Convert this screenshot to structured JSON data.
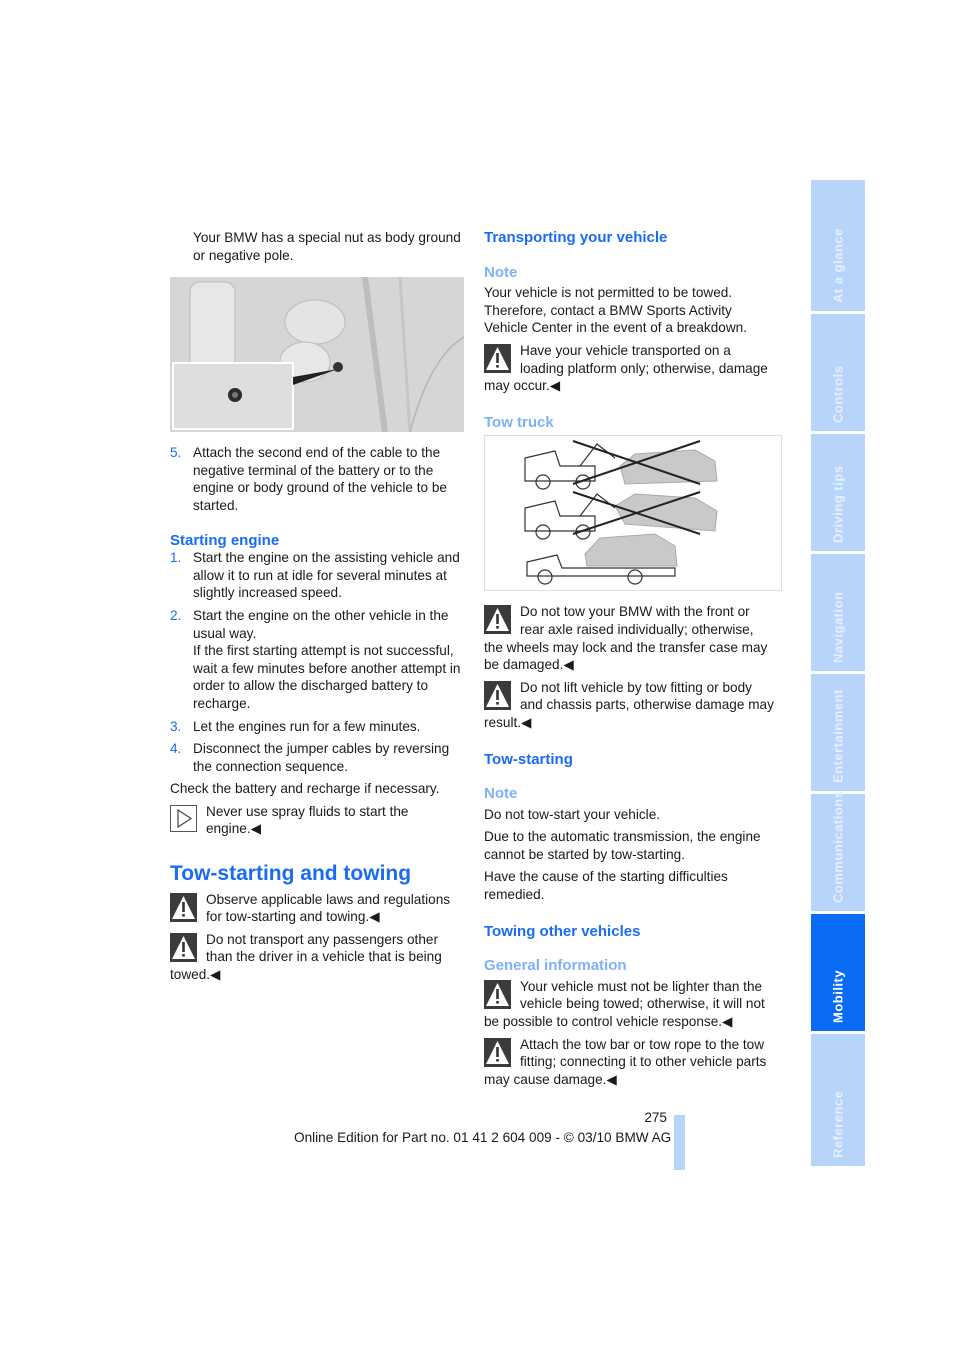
{
  "left_column": {
    "intro_text": "Your BMW has a special nut as body ground or negative pole.",
    "figure1_alt": "engine-compartment-ground-nut-illustration",
    "step5": {
      "num": "5.",
      "text": "Attach the second end of the cable to the negative terminal of the battery or to the engine or body ground of the vehicle to be started."
    },
    "starting_engine": {
      "heading": "Starting engine",
      "steps": [
        {
          "num": "1.",
          "text": "Start the engine on the assisting vehicle and allow it to run at idle for several minutes at slightly increased speed."
        },
        {
          "num": "2.",
          "text": "Start the engine on the other vehicle in the usual way.",
          "extra": "If the first starting attempt is not successful, wait a few minutes before another attempt in order to allow the discharged battery to recharge."
        },
        {
          "num": "3.",
          "text": "Let the engines run for a few minutes."
        },
        {
          "num": "4.",
          "text": "Disconnect the jumper cables by reversing the connection sequence."
        }
      ],
      "check_text": "Check the battery and recharge if necessary.",
      "note": "Never use spray fluids to start the engine.◀"
    },
    "tow_section": {
      "heading": "Tow-starting and towing",
      "warnings": [
        "Observe applicable laws and regulations for tow-starting and towing.◀",
        "Do not transport any passengers other than the driver in a vehicle that is being towed.◀"
      ]
    }
  },
  "right_column": {
    "transporting": {
      "heading": "Transporting your vehicle",
      "note_heading": "Note",
      "note_text": "Your vehicle is not permitted to be towed. Therefore, contact a BMW Sports Activity Vehicle Center in the event of a breakdown.",
      "warning": "Have your vehicle transported on a loading platform only; otherwise, damage may occur.◀"
    },
    "tow_truck": {
      "heading": "Tow truck",
      "figure_alt": "tow-truck-methods-illustration",
      "warnings": [
        "Do not tow your BMW with the front or rear axle raised individually; otherwise, the wheels may lock and the transfer case may be damaged.◀",
        "Do not lift vehicle by tow fitting or body and chassis parts, otherwise damage may result.◀"
      ]
    },
    "tow_starting": {
      "heading": "Tow-starting",
      "note_heading": "Note",
      "paragraphs": [
        "Do not tow-start your vehicle.",
        "Due to the automatic transmission, the engine cannot be started by tow-starting.",
        "Have the cause of the starting difficulties remedied."
      ]
    },
    "towing_other": {
      "heading": "Towing other vehicles",
      "sub_heading": "General information",
      "warnings": [
        "Your vehicle must not be lighter than the vehicle being towed; otherwise, it will not be possible to control vehicle response.◀",
        "Attach the tow bar or tow rope to the tow fitting; connecting it to other vehicle parts may cause damage.◀"
      ]
    }
  },
  "side_tabs": [
    {
      "label": "At a glance",
      "active": false
    },
    {
      "label": "Controls",
      "active": false
    },
    {
      "label": "Driving tips",
      "active": false
    },
    {
      "label": "Navigation",
      "active": false
    },
    {
      "label": "Entertainment",
      "active": false
    },
    {
      "label": "Communications",
      "active": false
    },
    {
      "label": "Mobility",
      "active": true
    },
    {
      "label": "Reference",
      "active": false
    }
  ],
  "footer": {
    "page_number": "275",
    "edition": "Online Edition for Part no. 01 41 2 604 009 - © 03/10 BMW AG"
  },
  "colors": {
    "heading_blue": "#1a6cf0",
    "subheading_light_blue": "#7fb1f7",
    "tab_inactive": "#b7d4fb",
    "tab_active": "#0a6cf5"
  }
}
